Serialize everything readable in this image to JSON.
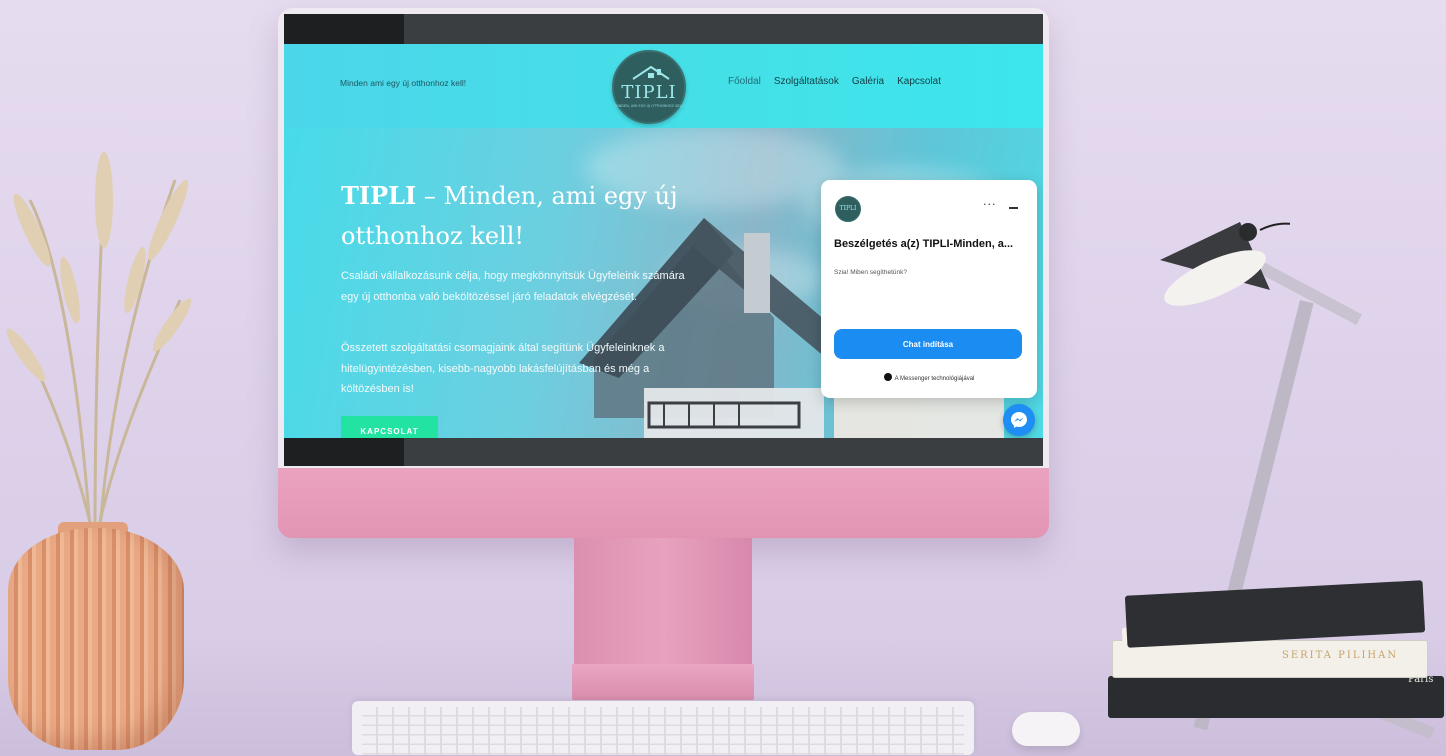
{
  "site": {
    "tagline": "Minden ami egy új otthonhoz kell!",
    "logo_text": "TIPLI",
    "logo_sub": "MINDEN, AMI EGY ÚJ OTTHONHOZ KELL",
    "nav": [
      {
        "label": "Főoldal"
      },
      {
        "label": "Szolgáltatások"
      },
      {
        "label": "Galéria"
      },
      {
        "label": "Kapcsolat"
      }
    ],
    "hero": {
      "title_bold": "TIPLI",
      "title_rest": " – Minden, ami egy új otthonhoz kell!",
      "paragraph1": "Családi vállalkozásunk célja, hogy megkönnyítsük Ügyfeleink számára egy új otthonba való beköltözéssel járó feladatok elvégzését.",
      "paragraph2": "Összetett szolgáltatási csomagjaink által segítünk Ügyfeleinknek a hitelügyintézésben, kisebb-nagyobb lakásfelújításban és még a költözésben is!",
      "cta_label": "KAPCSOLAT"
    }
  },
  "chat": {
    "avatar_text": "TIPLI",
    "more_label": "···",
    "title": "Beszélgetés a(z) TIPLI-Minden, a...",
    "message": "Szia! Miben segíthetünk?",
    "button_label": "Chat indítása",
    "footer": "A Messenger technológiájával"
  },
  "scene": {
    "book_title_1": "SERITA PILIHAN",
    "book_title_2": "Paris"
  },
  "colors": {
    "accent_cta": "#23e3a3",
    "messenger_blue": "#1b8cf2",
    "monitor_pink": "#e79fb9"
  }
}
